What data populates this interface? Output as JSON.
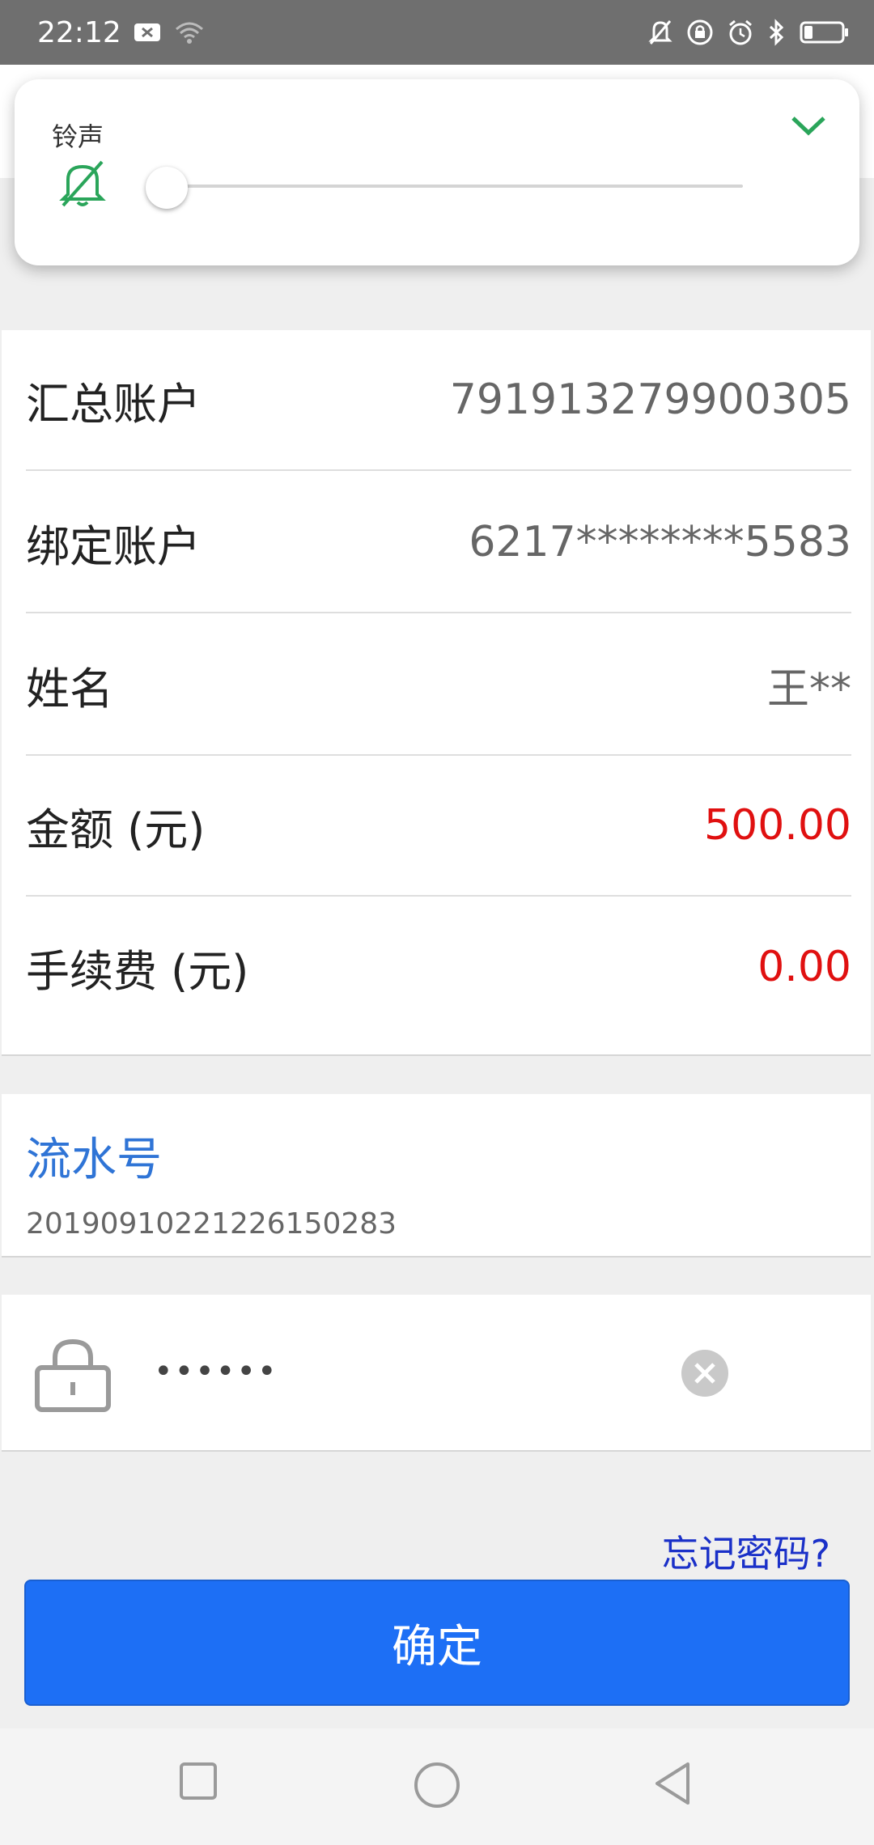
{
  "status_bar": {
    "time": "22:12",
    "left_icons": [
      "notification-x-icon",
      "wifi-icon"
    ],
    "right_icons": [
      "bell-off-icon",
      "lock-rotation-icon",
      "alarm-icon",
      "bluetooth-icon",
      "battery-icon"
    ]
  },
  "volume_panel": {
    "label": "铃声",
    "level": 0,
    "muted": true
  },
  "account": {
    "rows": [
      {
        "label": "汇总账户",
        "value": "791913279900305"
      },
      {
        "label": "绑定账户",
        "value": "6217********5583"
      },
      {
        "label": "姓名",
        "value": "王**"
      },
      {
        "label": "金额 (元)",
        "value": "500.00"
      },
      {
        "label": "手续费 (元)",
        "value": "0.00"
      }
    ]
  },
  "serial": {
    "title": "流水号",
    "number": "20190910221226150283"
  },
  "password": {
    "value": "••••••"
  },
  "forgot_password": "忘记密码?",
  "confirm_label": "确定",
  "colors": {
    "primary": "#1d6ff5",
    "amount_red": "#e01010",
    "link_blue": "#1a30c8",
    "serial_blue": "#2f74d6",
    "accent_green": "#2aa55a"
  }
}
